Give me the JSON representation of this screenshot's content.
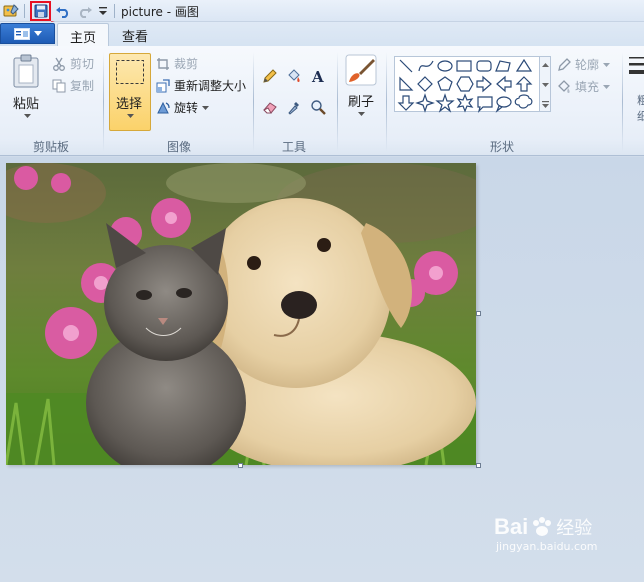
{
  "title": "picture - 画图",
  "tabs": {
    "file_icon": "paint-menu-icon",
    "home": "主页",
    "view": "查看"
  },
  "clipboard": {
    "paste": "粘贴",
    "cut": "剪切",
    "copy": "复制",
    "group": "剪贴板"
  },
  "image": {
    "select": "选择",
    "crop": "裁剪",
    "resize": "重新调整大小",
    "rotate": "旋转",
    "group": "图像"
  },
  "tools": {
    "group": "工具"
  },
  "brushes": {
    "label": "刷子"
  },
  "shapes": {
    "group": "形状",
    "outline": "轮廓",
    "fill": "填充"
  },
  "colors": {
    "size_fragment_1": "粗",
    "size_fragment_2": "细"
  },
  "watermark": {
    "brand": "Bai",
    "brand2": "经验",
    "url": "jingyan.baidu.com"
  },
  "accent": {
    "highlight": "#e81123",
    "file_tab": "#2563c4",
    "select_active": "#fbd26a"
  }
}
